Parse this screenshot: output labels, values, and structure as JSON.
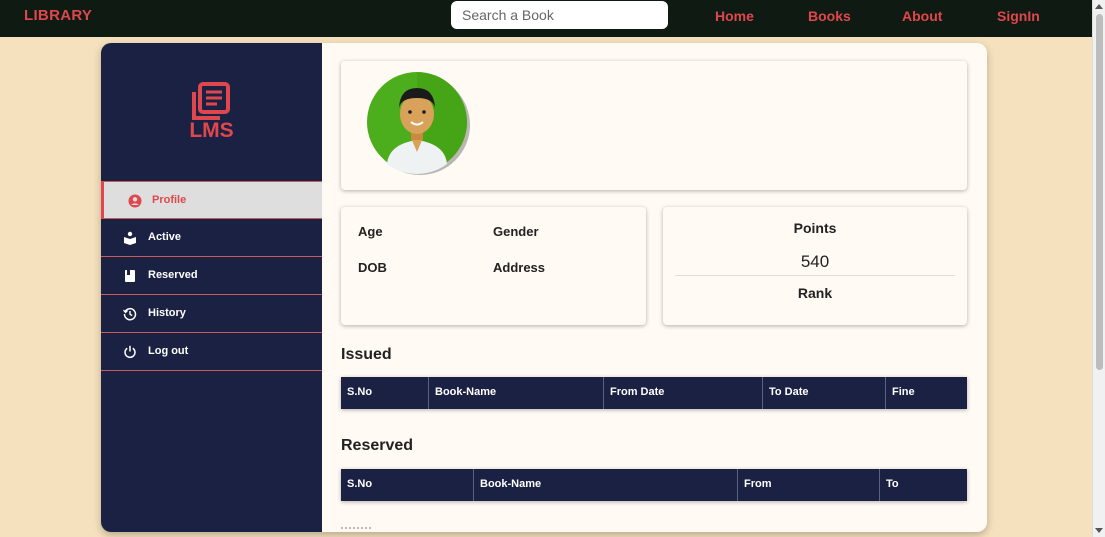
{
  "navbar": {
    "brand": "LIBRARY",
    "search_placeholder": "Search a Book",
    "links": [
      "Home",
      "Books",
      "About",
      "SignIn"
    ]
  },
  "sidebar": {
    "logo_text": "LMS",
    "items": [
      {
        "label": "Profile",
        "icon": "user-circle-icon",
        "active": true
      },
      {
        "label": "Active",
        "icon": "reading-icon",
        "active": false
      },
      {
        "label": "Reserved",
        "icon": "book-icon",
        "active": false
      },
      {
        "label": "History",
        "icon": "history-icon",
        "active": false
      },
      {
        "label": "Log out",
        "icon": "power-icon",
        "active": false
      }
    ]
  },
  "profile": {
    "age_label": "Age",
    "gender_label": "Gender",
    "dob_label": "DOB",
    "address_label": "Address",
    "points_label": "Points",
    "points_value": "540",
    "rank_label": "Rank"
  },
  "issued": {
    "title": "Issued",
    "columns": [
      "S.No",
      "Book-Name",
      "From Date",
      "To Date",
      "Fine"
    ]
  },
  "reserved": {
    "title": "Reserved",
    "columns": [
      "S.No",
      "Book-Name",
      "From",
      "To"
    ]
  },
  "colors": {
    "accent": "#e0474c",
    "navy": "#1a2143",
    "page_bg": "#f5e1bd",
    "navbar_bg": "#0f1a12"
  }
}
